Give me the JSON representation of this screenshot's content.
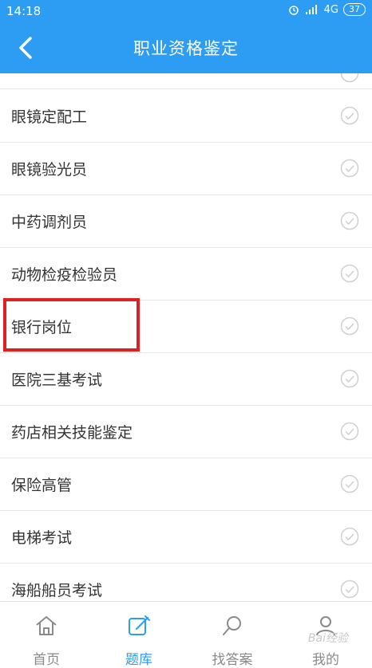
{
  "status": {
    "time": "14:18",
    "network": "4G",
    "battery": "37"
  },
  "header": {
    "title": "职业资格鉴定"
  },
  "list": {
    "items": [
      "眼镜定配工",
      "眼镜验光员",
      "中药调剂员",
      "动物检疫检验员",
      "银行岗位",
      "医院三基考试",
      "药店相关技能鉴定",
      "保险高管",
      "电梯考试",
      "海船船员考试"
    ],
    "highlighted_item": "银行岗位"
  },
  "tabbar": {
    "tabs": [
      {
        "label": "首页",
        "icon": "home-icon"
      },
      {
        "label": "题库",
        "icon": "edit-icon",
        "active": true
      },
      {
        "label": "找答案",
        "icon": "search-icon"
      },
      {
        "label": "我的",
        "icon": "user-icon"
      }
    ]
  },
  "colors": {
    "primary": "#2c9df2",
    "highlight_box": "#e02020"
  },
  "watermark": "Bai经验"
}
